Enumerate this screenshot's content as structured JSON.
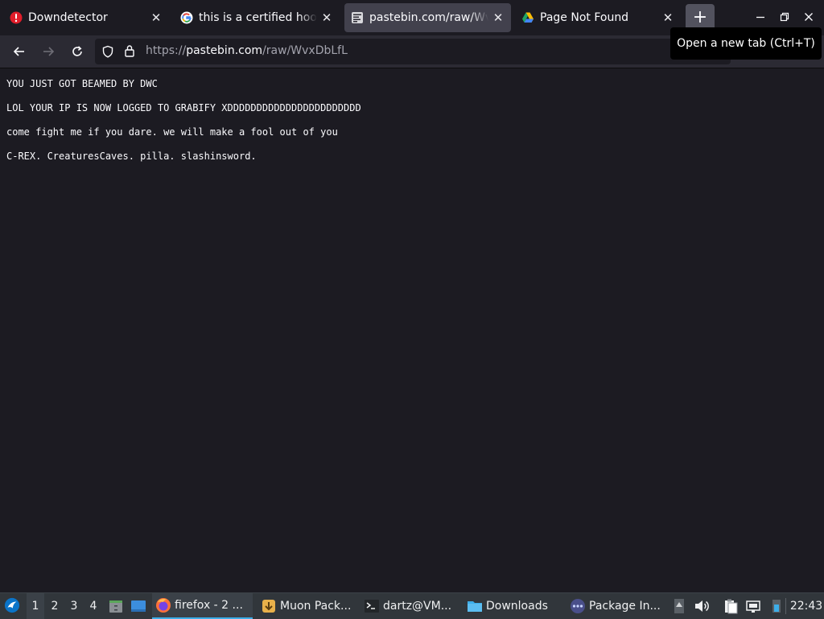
{
  "browser": {
    "tabs": [
      {
        "title": "Downdetector",
        "favicon": "downdetector-alert-icon",
        "active": false
      },
      {
        "title": "this is a certified hood classic",
        "favicon": "google-g-icon",
        "active": false
      },
      {
        "title": "pastebin.com/raw/WvxDbLfL",
        "favicon": "pastebin-icon",
        "active": true
      },
      {
        "title": "Page Not Found",
        "favicon": "google-drive-icon",
        "active": false
      }
    ],
    "new_tab_symbol": "+",
    "tooltip": "Open a new tab (Ctrl+T)",
    "url": {
      "scheme": "https://",
      "host": "pastebin.com",
      "path": "/raw/WvxDbLfL"
    }
  },
  "page": {
    "lines": [
      "YOU JUST GOT BEAMED BY DWC",
      "LOL YOUR IP IS NOW LOGGED TO GRABIFY XDDDDDDDDDDDDDDDDDDDDDDD",
      "come fight me if you dare. we will make a fool out of you",
      "C-REX. CreaturesCaves. pilla. slashinsword."
    ]
  },
  "taskbar": {
    "desktops": [
      "1",
      "2",
      "3",
      "4"
    ],
    "active_desktop": "1",
    "tasks": [
      {
        "label": "firefox - 2 ...",
        "icon": "firefox-icon",
        "active": true
      },
      {
        "label": "Muon Pack...",
        "icon": "muon-package-icon",
        "active": false
      },
      {
        "label": "dartz@VM...",
        "icon": "terminal-icon",
        "active": false
      },
      {
        "label": "Downloads",
        "icon": "folder-icon",
        "active": false
      },
      {
        "label": "Package In...",
        "icon": "package-installer-icon",
        "active": false
      }
    ],
    "clock": "22:43"
  },
  "colors": {
    "page_bg": "#1c1b22",
    "toolbar_bg": "#2b2a33",
    "active_tab_bg": "#42414d",
    "taskbar_bg": "#31363b",
    "taskbar_accent": "#3daee9"
  }
}
